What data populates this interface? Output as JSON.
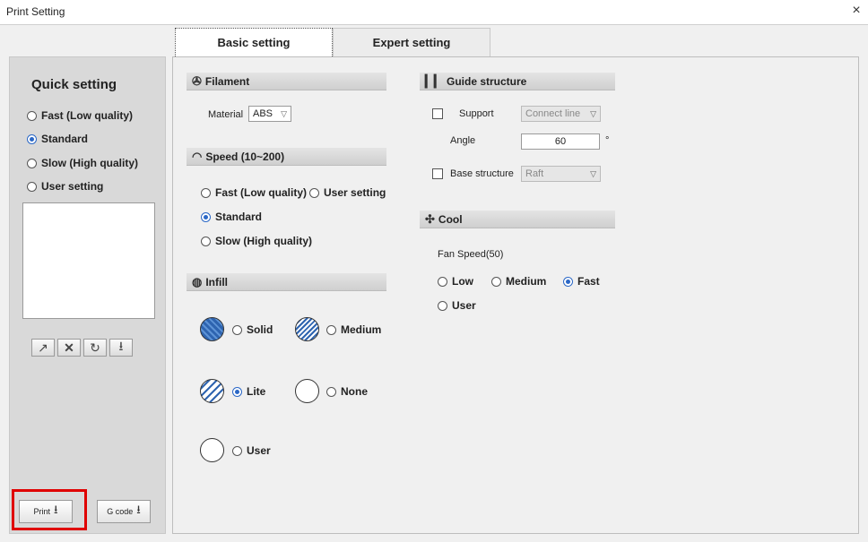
{
  "window": {
    "title": "Print Setting",
    "close_label": "×"
  },
  "tabs": [
    {
      "label": "Basic setting"
    },
    {
      "label": "Expert setting"
    }
  ],
  "quick_setting": {
    "title": "Quick setting",
    "options": [
      {
        "label": "Fast (Low quality)",
        "selected": false
      },
      {
        "label": "Standard",
        "selected": true
      },
      {
        "label": "Slow (High quality)",
        "selected": false
      },
      {
        "label": "User setting",
        "selected": false
      }
    ],
    "tool_icons": [
      "export-icon",
      "delete-icon",
      "refresh-icon",
      "download-icon"
    ],
    "print_label": "Print",
    "gcode_label": "G code"
  },
  "filament": {
    "title": "Filament",
    "material_label": "Material",
    "material_value": "ABS"
  },
  "speed": {
    "title": "Speed (10~200)",
    "options": [
      {
        "label": "Fast (Low quality)",
        "selected": false
      },
      {
        "label": "User setting",
        "selected": false
      },
      {
        "label": "Standard",
        "selected": true
      },
      {
        "label": "Slow (High quality)",
        "selected": false
      }
    ]
  },
  "infill": {
    "title": "Infill",
    "options": [
      {
        "label": "Solid",
        "selected": false
      },
      {
        "label": "Medium",
        "selected": false
      },
      {
        "label": "Lite",
        "selected": true
      },
      {
        "label": "None",
        "selected": false
      },
      {
        "label": "User",
        "selected": false
      }
    ]
  },
  "guide": {
    "title": "Guide structure",
    "support_label": "Support",
    "support_value": "Connect line",
    "angle_label": "Angle",
    "angle_value": "60",
    "angle_unit": "°",
    "base_label": "Base structure",
    "base_value": "Raft"
  },
  "cool": {
    "title": "Cool",
    "fan_label": "Fan Speed(50)",
    "options": [
      {
        "label": "Low",
        "selected": false
      },
      {
        "label": "Medium",
        "selected": false
      },
      {
        "label": "Fast",
        "selected": true
      },
      {
        "label": "User",
        "selected": false
      }
    ]
  },
  "colors": {
    "accent": "#2a67c6",
    "highlight": "#e00000"
  }
}
